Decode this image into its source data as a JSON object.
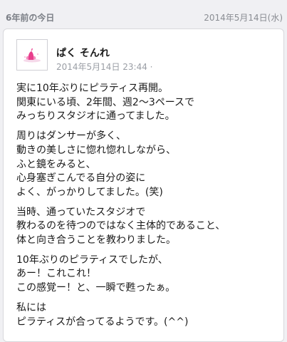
{
  "header": {
    "left_label": "6年前の今日",
    "date": "2014年5月14日(水)"
  },
  "post": {
    "author": "ぱく そんれ",
    "timestamp": "2014年5月14日 23:44 ·",
    "avatar_icon": "pink-flower-avatar-icon",
    "paragraphs": [
      "実に10年ぶりにピラティス再開。\n関東にいる頃、2年間、週2〜3ペースで\nみっちりスタジオに通ってました。",
      "周りはダンサーが多く、\n動きの美しさに惚れ惚れしながら、\nふと鏡をみると、\n心身塞ぎこんでる自分の姿に\nよく、がっかりしてました。(笑)",
      "当時、通っていたスタジオで\n教わるのを待つのではなく主体的であること、\n体と向き合うことを教わりました。",
      "10年ぶりのピラティスでしたが、\nあー！これこれ！\nこの感覚ー！と、一瞬で甦ったぁ。",
      "私には\nピラティスが合ってるようです。(^^)"
    ]
  },
  "colors": {
    "page_bg": "#f0f0f3",
    "card_bg": "#ffffff",
    "accent_pink": "#e83e8c"
  }
}
